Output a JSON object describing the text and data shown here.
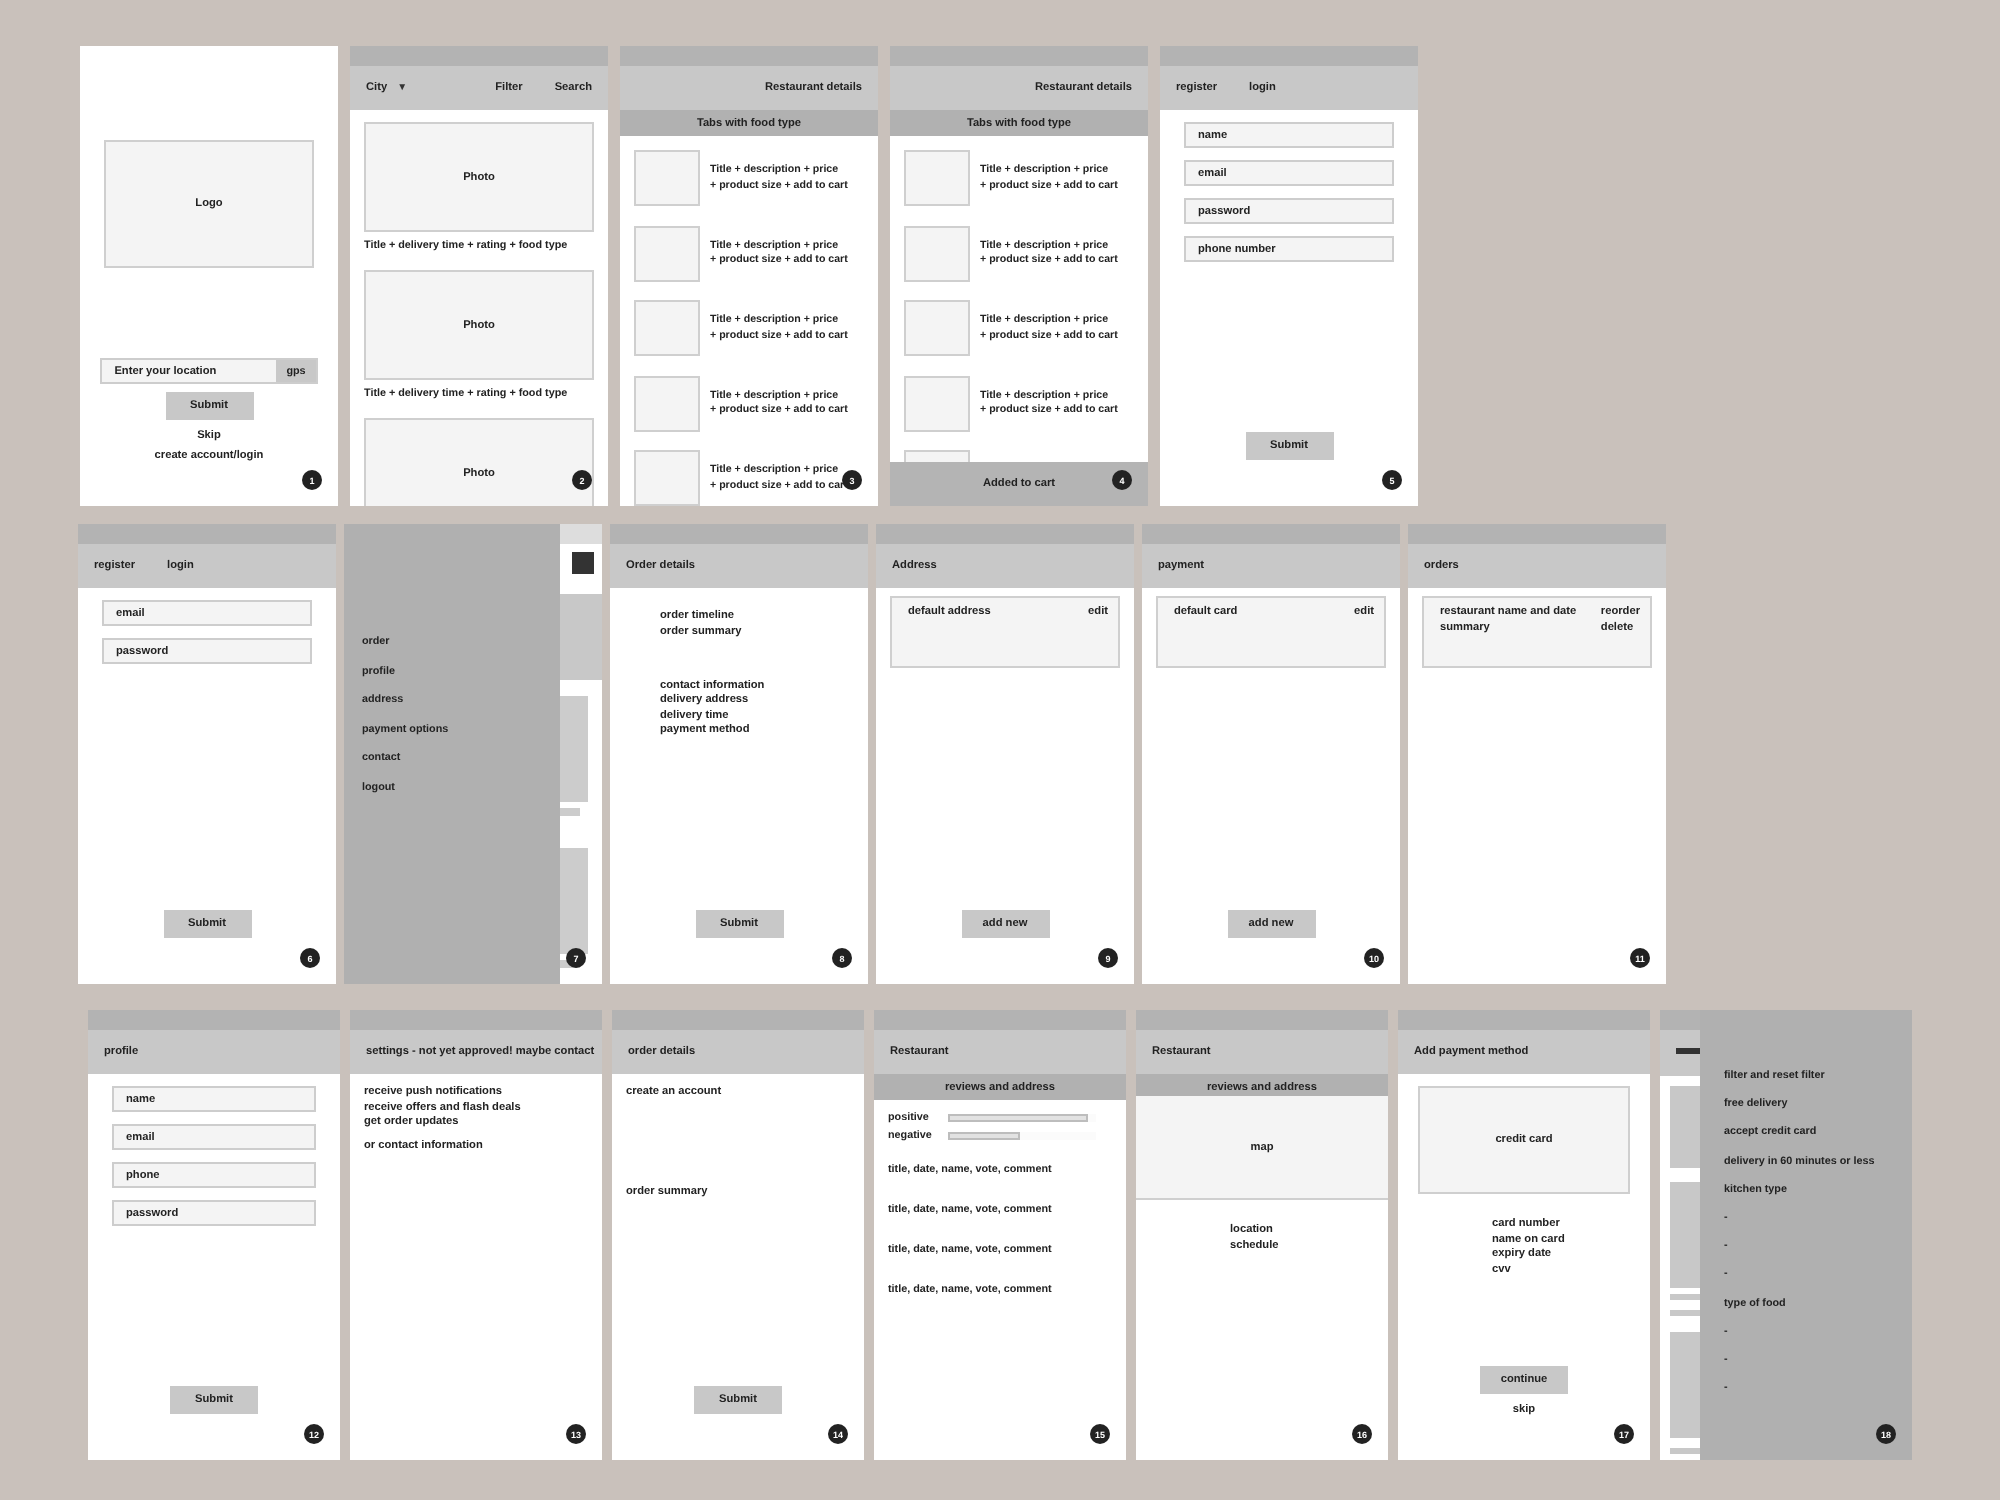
{
  "rows": [
    {
      "screens": [
        {
          "kind": "screen",
          "number": "1",
          "blocks": [
            {
              "kind": "logo",
              "label": "Logo"
            }
          ],
          "footer": [
            {
              "kind": "field",
              "placeholder": "Enter your location",
              "action": "gps"
            },
            {
              "kind": "button",
              "label": "Submit"
            },
            {
              "kind": "link",
              "label": "Skip"
            },
            {
              "kind": "link",
              "label": "create account/login"
            }
          ]
        },
        {
          "kind": "screen",
          "number": "2",
          "header": {
            "left": [
              {
                "label": "City",
                "caret": "▼"
              }
            ],
            "right": [
              {
                "label": "Filter"
              },
              {
                "label": "Search"
              }
            ]
          },
          "blocks": [
            {
              "kind": "photo",
              "label": "Photo"
            },
            {
              "kind": "caption",
              "text": "Title + delivery time + rating + food type"
            },
            {
              "kind": "photo",
              "label": "Photo"
            },
            {
              "kind": "caption",
              "text": "Title + delivery time + rating + food type"
            },
            {
              "kind": "photo",
              "label": "Photo"
            }
          ]
        },
        {
          "kind": "screen",
          "number": "3",
          "header": {
            "right": [
              {
                "label": "Restaurant details"
              }
            ]
          },
          "subheader": "Tabs with food type",
          "blocks": [
            {
              "kind": "product",
              "lines": [
                "Title + description + price",
                "+ product size + add to cart"
              ]
            },
            {
              "kind": "product",
              "lines": [
                "Title + description + price",
                "+ product size + add to cart"
              ]
            },
            {
              "kind": "product",
              "lines": [
                "Title + description + price",
                "+ product size + add to cart"
              ]
            },
            {
              "kind": "product",
              "lines": [
                "Title + description + price",
                "+ product size + add to cart"
              ]
            },
            {
              "kind": "product",
              "lines": [
                "Title + description + price",
                "+ product size + add to car"
              ]
            }
          ]
        },
        {
          "kind": "screen",
          "number": "4",
          "header": {
            "right": [
              {
                "label": "Restaurant details"
              }
            ]
          },
          "subheader": "Tabs with food type",
          "blocks": [
            {
              "kind": "product",
              "lines": [
                "Title + description + price",
                "+ product size + add to cart"
              ]
            },
            {
              "kind": "product",
              "lines": [
                "Title + description + price",
                "+ product size + add to cart"
              ]
            },
            {
              "kind": "product",
              "lines": [
                "Title + description + price",
                "+ product size + add to cart"
              ]
            },
            {
              "kind": "product",
              "lines": [
                "Title + description + price",
                "+ product size + add to cart"
              ]
            },
            {
              "kind": "thumb"
            }
          ],
          "bottom_bar": "Added to cart"
        },
        {
          "kind": "screen",
          "number": "5",
          "header": {
            "left": [
              {
                "label": "register"
              },
              {
                "label": "login"
              }
            ]
          },
          "blocks": [
            {
              "kind": "field",
              "placeholder": "name"
            },
            {
              "kind": "field",
              "placeholder": "email"
            },
            {
              "kind": "field",
              "placeholder": "password"
            },
            {
              "kind": "field",
              "placeholder": "phone number"
            }
          ],
          "footer": [
            {
              "kind": "button",
              "label": "Submit"
            }
          ]
        }
      ]
    },
    {
      "screens": [
        {
          "kind": "screen",
          "number": "6",
          "header": {
            "left": [
              {
                "label": "register"
              },
              {
                "label": "login"
              }
            ]
          },
          "blocks": [
            {
              "kind": "field",
              "placeholder": "email"
            },
            {
              "kind": "field",
              "placeholder": "password"
            }
          ],
          "footer": [
            {
              "kind": "button",
              "label": "Submit"
            }
          ]
        },
        {
          "kind": "menu-drawer",
          "number": "7",
          "items": [
            "order",
            "profile",
            "address",
            "payment options",
            "contact",
            "logout"
          ]
        },
        {
          "kind": "screen",
          "number": "8",
          "header": {
            "left": [
              {
                "label": "Order details"
              }
            ]
          },
          "blocks": [
            {
              "kind": "inset-list",
              "lines": [
                "order timeline",
                "order summary"
              ]
            },
            {
              "kind": "inset-list",
              "lines": [
                "contact information",
                "delivery address",
                "delivery time",
                "payment method"
              ]
            }
          ],
          "footer": [
            {
              "kind": "button",
              "label": "Submit"
            }
          ]
        },
        {
          "kind": "screen",
          "number": "9",
          "header": {
            "left": [
              {
                "label": "Address"
              }
            ]
          },
          "blocks": [
            {
              "kind": "card",
              "left": [
                "default address"
              ],
              "right": [
                "edit"
              ]
            }
          ],
          "footer": [
            {
              "kind": "button",
              "label": "add new"
            }
          ]
        },
        {
          "kind": "screen",
          "number": "10",
          "header": {
            "left": [
              {
                "label": "payment"
              }
            ]
          },
          "blocks": [
            {
              "kind": "card",
              "left": [
                "default card"
              ],
              "right": [
                "edit"
              ]
            }
          ],
          "footer": [
            {
              "kind": "button",
              "label": "add new"
            }
          ]
        },
        {
          "kind": "screen",
          "number": "11",
          "header": {
            "left": [
              {
                "label": "orders"
              }
            ]
          },
          "blocks": [
            {
              "kind": "card",
              "left": [
                "restaurant name and date",
                "summary"
              ],
              "right": [
                "reorder",
                "delete"
              ]
            }
          ]
        }
      ]
    },
    {
      "screens": [
        {
          "kind": "screen",
          "number": "12",
          "header": {
            "left": [
              {
                "label": "profile"
              }
            ]
          },
          "blocks": [
            {
              "kind": "field",
              "placeholder": "name"
            },
            {
              "kind": "field",
              "placeholder": "email"
            },
            {
              "kind": "field",
              "placeholder": "phone"
            },
            {
              "kind": "field",
              "placeholder": "password"
            }
          ],
          "footer": [
            {
              "kind": "button",
              "label": "Submit"
            }
          ]
        },
        {
          "kind": "screen",
          "number": "13",
          "header": {
            "left": [
              {
                "label": "settings - not yet approved! maybe contact"
              }
            ]
          },
          "blocks": [
            {
              "kind": "list",
              "lines": [
                "receive push notifications",
                "receive offers and flash deals",
                "get order updates"
              ]
            },
            {
              "kind": "list",
              "lines": [
                "or contact information"
              ]
            }
          ]
        },
        {
          "kind": "screen",
          "number": "14",
          "header": {
            "left": [
              {
                "label": "order details"
              }
            ]
          },
          "blocks": [
            {
              "kind": "list",
              "lines": [
                "create an account"
              ]
            },
            {
              "kind": "gap"
            },
            {
              "kind": "list",
              "lines": [
                "order summary"
              ]
            }
          ],
          "footer": [
            {
              "kind": "button",
              "label": "Submit"
            }
          ]
        },
        {
          "kind": "screen",
          "number": "15",
          "header": {
            "left": [
              {
                "label": "Restaurant"
              }
            ]
          },
          "subheader": "reviews and address",
          "blocks": [
            {
              "kind": "meter",
              "label": "positive",
              "level": 0.95
            },
            {
              "kind": "meter",
              "label": "negative",
              "level": 0.48
            },
            {
              "kind": "review",
              "text": "title, date, name, vote, comment"
            },
            {
              "kind": "review",
              "text": "title, date, name, vote, comment"
            },
            {
              "kind": "review",
              "text": "title, date, name, vote, comment"
            },
            {
              "kind": "review",
              "text": "title, date, name, vote, comment"
            }
          ]
        },
        {
          "kind": "screen",
          "number": "16",
          "header": {
            "left": [
              {
                "label": "Restaurant"
              }
            ]
          },
          "subheader": "reviews and address",
          "blocks": [
            {
              "kind": "map",
              "label": "map"
            },
            {
              "kind": "center-list",
              "lines": [
                "location",
                "schedule"
              ]
            }
          ]
        },
        {
          "kind": "screen",
          "number": "17",
          "header": {
            "left": [
              {
                "label": "Add payment method"
              }
            ]
          },
          "blocks": [
            {
              "kind": "card-art",
              "label": "credit card"
            },
            {
              "kind": "center-list",
              "lines": [
                "card number",
                "name on card",
                "expiry date",
                "cvv"
              ]
            }
          ],
          "footer": [
            {
              "kind": "button",
              "label": "continue"
            },
            {
              "kind": "link",
              "label": "skip"
            }
          ]
        },
        {
          "kind": "filter-drawer",
          "number": "18",
          "items": [
            "filter and reset filter",
            "free delivery",
            "accept credit card",
            "delivery in 60 minutes or less",
            "kitchen type",
            "-",
            "-",
            "-",
            "type of food",
            "-",
            "-",
            "-"
          ]
        }
      ]
    }
  ]
}
